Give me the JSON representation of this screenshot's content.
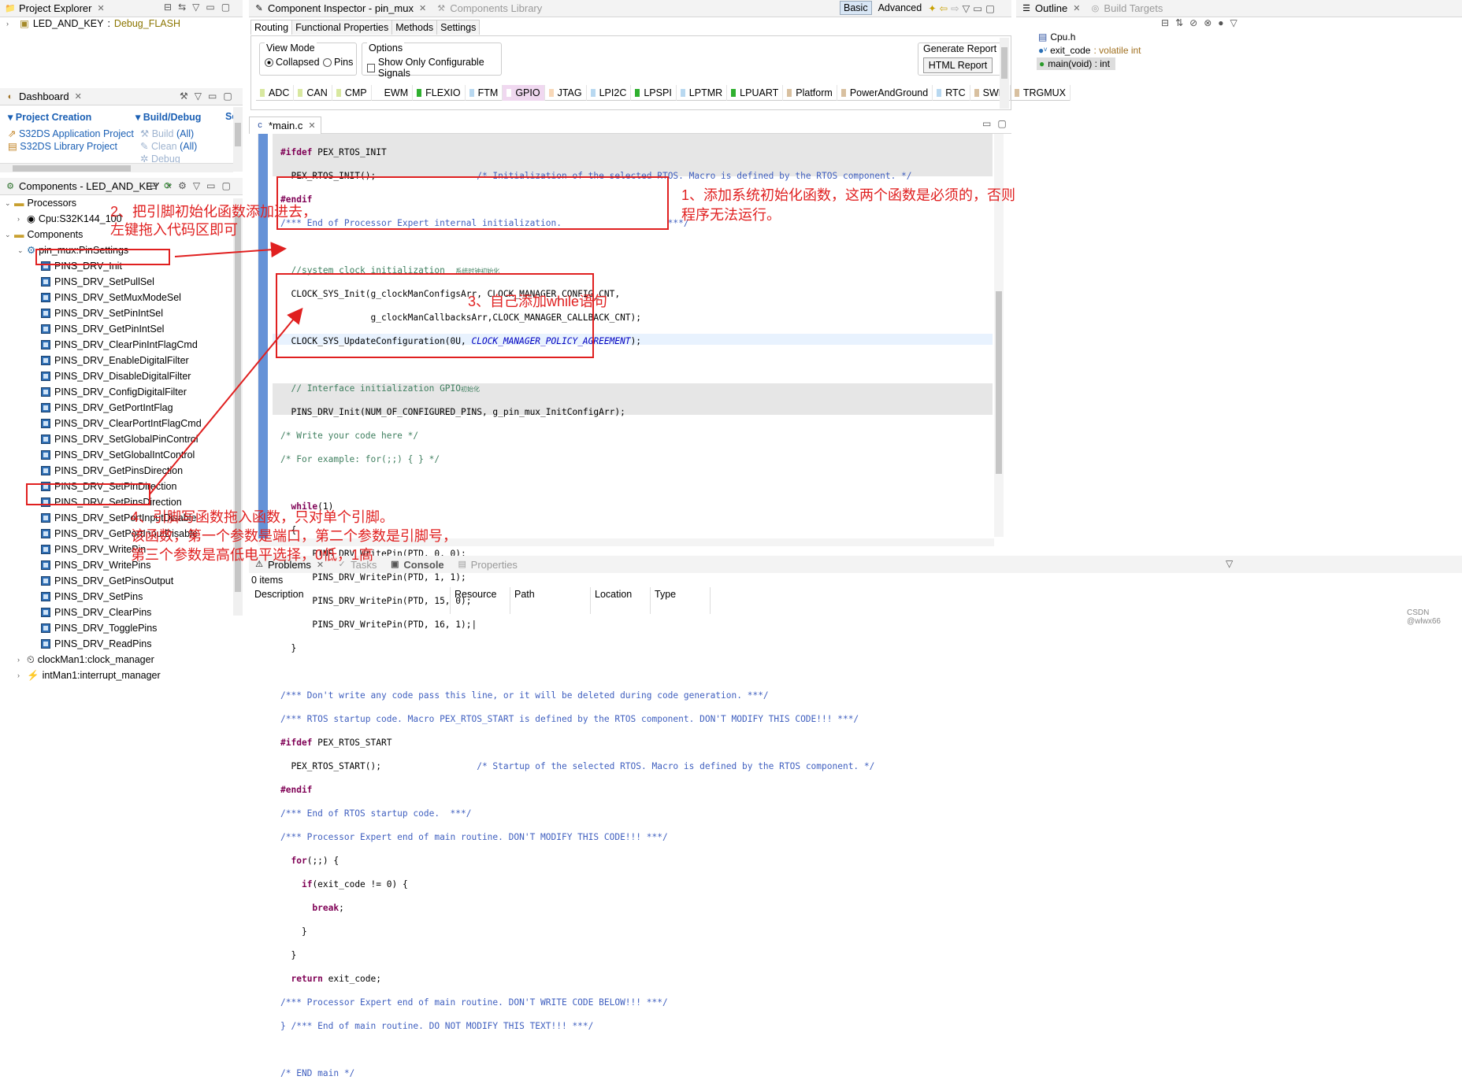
{
  "project_explorer": {
    "title": "Project Explorer",
    "item_name": "LED_AND_KEY",
    "item_config": "Debug_FLASH"
  },
  "dashboard": {
    "title": "Dashboard",
    "project_creation": "Project Creation",
    "app_project": "S32DS Application Project",
    "lib_project": "S32DS Library Project",
    "build_debug": "Build/Debug",
    "build": "Build",
    "clean": "Clean",
    "all": "(All)",
    "debug": "Debug",
    "se": "Se"
  },
  "components": {
    "title": "Components - LED_AND_KEY",
    "processors": "Processors",
    "cpu": "Cpu:S32K144_100",
    "components_label": "Components",
    "pin_mux": "pin_mux:PinSettings",
    "pins": [
      "PINS_DRV_Init",
      "PINS_DRV_SetPullSel",
      "PINS_DRV_SetMuxModeSel",
      "PINS_DRV_SetPinIntSel",
      "PINS_DRV_GetPinIntSel",
      "PINS_DRV_ClearPinIntFlagCmd",
      "PINS_DRV_EnableDigitalFilter",
      "PINS_DRV_DisableDigitalFilter",
      "PINS_DRV_ConfigDigitalFilter",
      "PINS_DRV_GetPortIntFlag",
      "PINS_DRV_ClearPortIntFlagCmd",
      "PINS_DRV_SetGlobalPinControl",
      "PINS_DRV_SetGlobalIntControl",
      "PINS_DRV_GetPinsDirection",
      "PINS_DRV_SetPinDirection",
      "PINS_DRV_SetPinsDirection",
      "PINS_DRV_SetPortInputDisable",
      "PINS_DRV_GetPortInputDisable",
      "PINS_DRV_WritePin",
      "PINS_DRV_WritePins",
      "PINS_DRV_GetPinsOutput",
      "PINS_DRV_SetPins",
      "PINS_DRV_ClearPins",
      "PINS_DRV_TogglePins",
      "PINS_DRV_ReadPins"
    ],
    "clock": "clockMan1:clock_manager",
    "intman": "intMan1:interrupt_manager"
  },
  "inspector": {
    "title": "Component Inspector - pin_mux",
    "library": "Components Library",
    "basic": "Basic",
    "advanced": "Advanced",
    "tabs": [
      "Routing",
      "Functional Properties",
      "Methods",
      "Settings"
    ],
    "view_mode": "View Mode",
    "collapsed": "Collapsed",
    "pins": "Pins",
    "options": "Options",
    "show_only": "Show Only Configurable Signals",
    "generate_report": "Generate Report",
    "html_report": "HTML Report",
    "periph": [
      "ADC",
      "CAN",
      "CMP",
      "EWM",
      "FLEXIO",
      "FTM",
      "GPIO",
      "JTAG",
      "LPI2C",
      "LPSPI",
      "LPTMR",
      "LPUART",
      "Platform",
      "PowerAndGround",
      "RTC",
      "SWD",
      "TRGMUX"
    ]
  },
  "editor": {
    "tab": "*main.c"
  },
  "outline": {
    "title": "Outline",
    "build_targets": "Build Targets",
    "cpu_h": "Cpu.h",
    "exit_code": "exit_code",
    "exit_type": " : volatile int",
    "main": "main(void) : int"
  },
  "problems": {
    "problems": "Problems",
    "tasks": "Tasks",
    "console": "Console",
    "properties": "Properties",
    "items": "0 items",
    "cols": [
      "Description",
      "Resource",
      "Path",
      "Location",
      "Type"
    ]
  },
  "annotations": {
    "a1_line1": "1、添加系统初始化函数，这两个函数是必须的，否则",
    "a1_line2": "程序无法运行。",
    "a2_line1": "2、把引脚初始化函数添加进去，",
    "a2_line2": "左键拖入代码区即可",
    "a3": "3、自己添加while语句",
    "a4_line1": "4、引脚写函数拖入函数，只对单个引脚。",
    "a4_line2": "该函数，第一个参数是端口，第二个参数是引脚号，",
    "a4_line3": "第三个参数是高低电平选择，0低，1高"
  },
  "watermark": "CSDN @wlwx66"
}
